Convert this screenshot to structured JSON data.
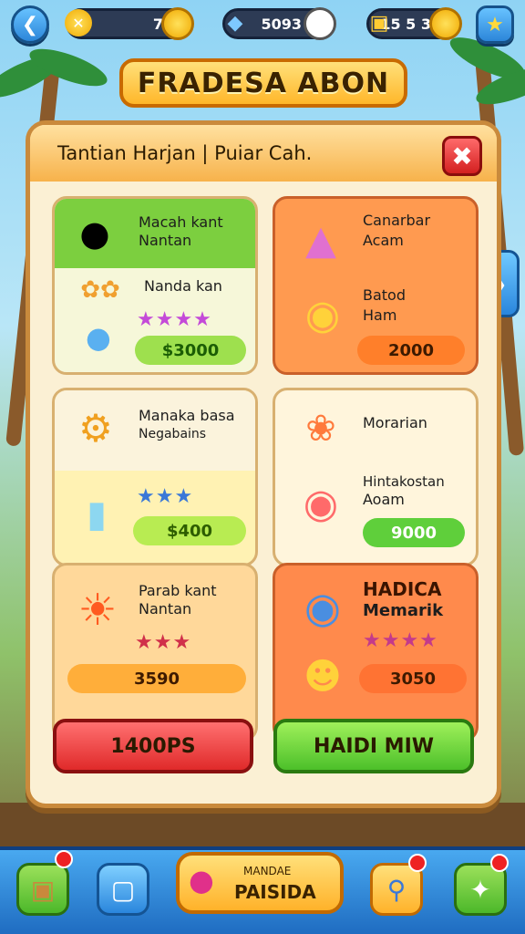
{
  "topbar": {
    "back_icon": "back-arrow-icon",
    "currency1_value": "7",
    "currency2_value": "5093",
    "currency3_value": "15 5 3",
    "favorite_icon": "star-icon"
  },
  "title": "FRADESA ABON",
  "panel": {
    "header": "Tantian Harjan | Puiar Cah."
  },
  "cards": [
    {
      "line1": "Macah kant",
      "line2": "Nantan",
      "line3": "Nanda kan",
      "stars": "★★★★",
      "price": "$3000",
      "colors": {
        "bg": "#f6f7d9",
        "top": "#7ccf3f",
        "price": "#9ee04e"
      }
    },
    {
      "line1": "Canarbar",
      "line2": "Acam",
      "line3": "Batod",
      "line4": "Ham",
      "price": "2000",
      "colors": {
        "bg": "#ff9a50",
        "price": "#ff7f2a"
      }
    },
    {
      "line1": "Manaka basa",
      "line2": "Negabains",
      "stars": "★★★",
      "price": "$400",
      "colors": {
        "bg": "#fff2b3",
        "price": "#b8ec52"
      }
    },
    {
      "line1": "Morarian",
      "line2": "Hintakostan",
      "line3": "Aoam",
      "price": "9000",
      "colors": {
        "bg": "#fff5dc",
        "price": "#5fcf3b"
      }
    },
    {
      "line1": "Parab kant",
      "line2": "Nantan",
      "stars": "★★★",
      "price": "3590",
      "colors": {
        "bg": "#ffd89a",
        "price": "#ffae3a"
      }
    },
    {
      "line1": "HADICA",
      "line2": "Memarik",
      "stars": "★★★★",
      "price": "3050",
      "colors": {
        "bg": "#ff8a4c",
        "price": "#ff7333"
      }
    }
  ],
  "buttons": {
    "left": "1400PS",
    "right": "HAIDI MIW"
  },
  "bottom_nav": {
    "center_line1": "MANDAE",
    "center_line2": "PAISIDA"
  }
}
